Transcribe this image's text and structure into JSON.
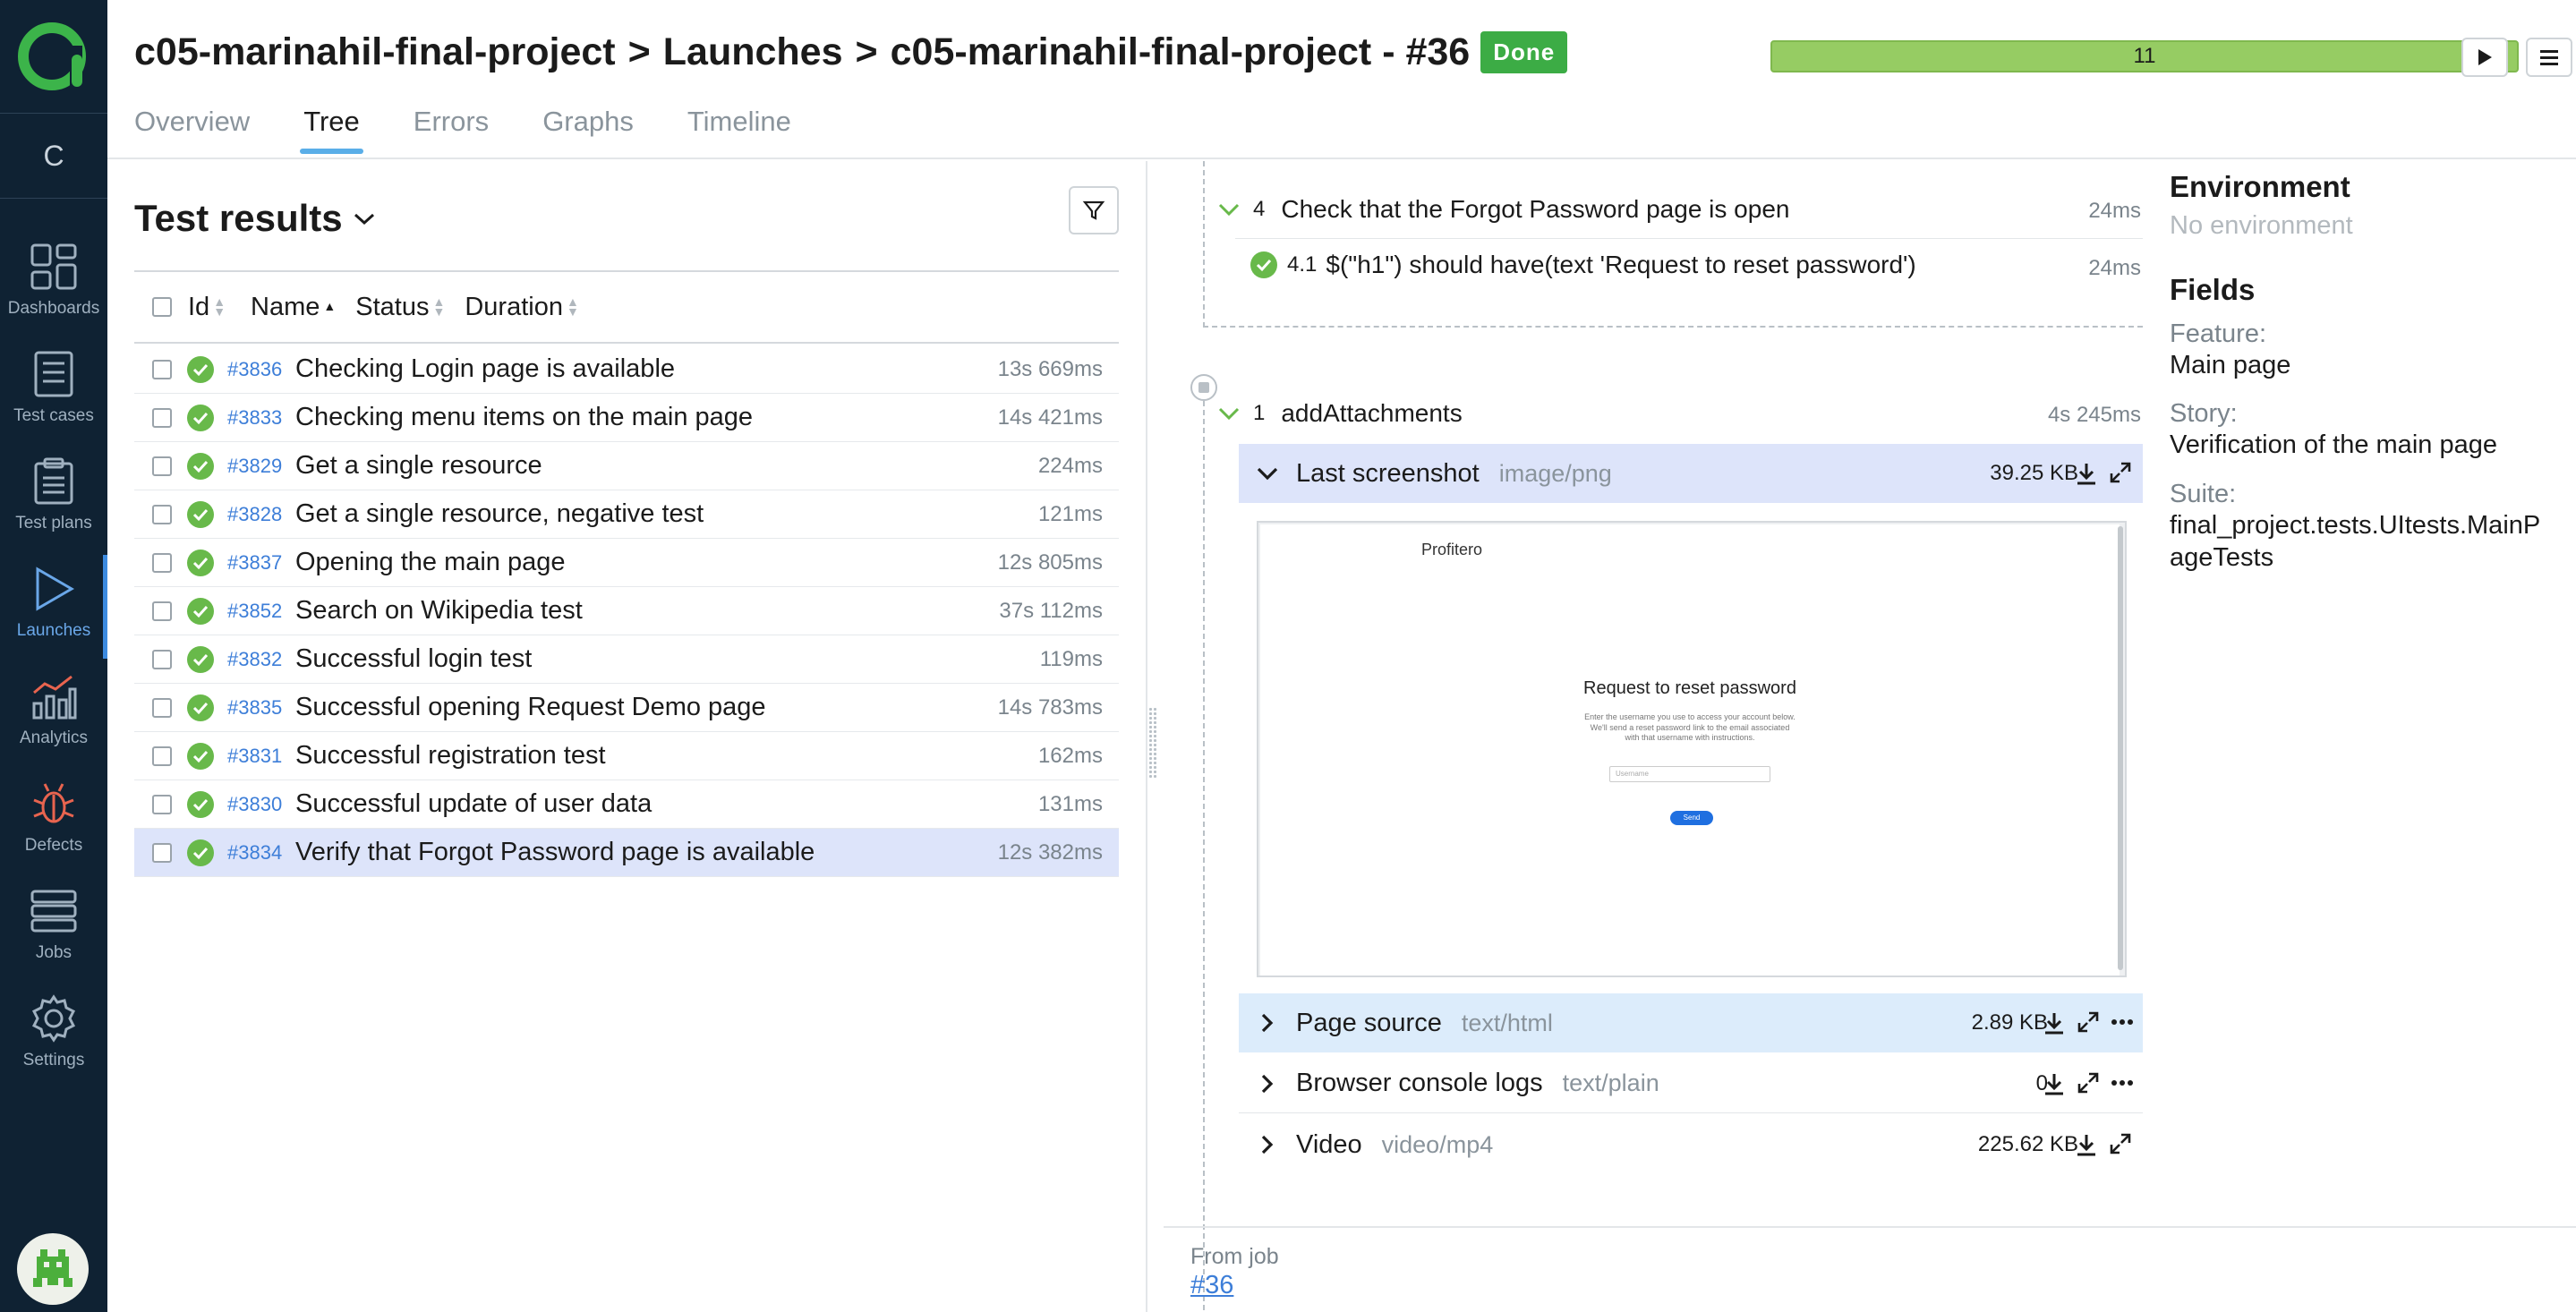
{
  "sidebar": {
    "project_initial": "C",
    "items": [
      {
        "label": "Dashboards",
        "icon": "dashboards-icon"
      },
      {
        "label": "Test cases",
        "icon": "test-cases-icon"
      },
      {
        "label": "Test plans",
        "icon": "test-plans-icon"
      },
      {
        "label": "Launches",
        "icon": "launches-icon",
        "active": true
      },
      {
        "label": "Analytics",
        "icon": "analytics-icon"
      },
      {
        "label": "Defects",
        "icon": "bug-icon"
      },
      {
        "label": "Jobs",
        "icon": "jobs-icon"
      },
      {
        "label": "Settings",
        "icon": "gear-icon"
      }
    ]
  },
  "header": {
    "breadcrumb": [
      "c05-marinahil-final-project",
      "Launches",
      "c05-marinahil-final-project - #36"
    ],
    "separator": ">",
    "status_badge": "Done",
    "progress_count": "11",
    "tabs": [
      "Overview",
      "Tree",
      "Errors",
      "Graphs",
      "Timeline"
    ],
    "active_tab": "Tree"
  },
  "test_results": {
    "title": "Test results",
    "columns": [
      "Id",
      "Name",
      "Status",
      "Duration"
    ],
    "rows": [
      {
        "id": "#3836",
        "name": "Checking Login page is available",
        "duration": "13s 669ms"
      },
      {
        "id": "#3833",
        "name": "Checking menu items on the main page",
        "duration": "14s 421ms"
      },
      {
        "id": "#3829",
        "name": "Get a single resource",
        "duration": "224ms"
      },
      {
        "id": "#3828",
        "name": "Get a single resource, negative test",
        "duration": "121ms"
      },
      {
        "id": "#3837",
        "name": "Opening the main page",
        "duration": "12s 805ms"
      },
      {
        "id": "#3852",
        "name": "Search on Wikipedia test",
        "duration": "37s 112ms"
      },
      {
        "id": "#3832",
        "name": "Successful login test",
        "duration": "119ms"
      },
      {
        "id": "#3835",
        "name": "Successful opening Request Demo page",
        "duration": "14s 783ms"
      },
      {
        "id": "#3831",
        "name": "Successful registration test",
        "duration": "162ms"
      },
      {
        "id": "#3830",
        "name": "Successful update of user data",
        "duration": "131ms"
      },
      {
        "id": "#3834",
        "name": "Verify that Forgot Password page is available",
        "duration": "12s 382ms",
        "selected": true
      }
    ]
  },
  "steps": {
    "step4": {
      "num": "4",
      "title": "Check that the Forgot Password page is open",
      "duration": "24ms"
    },
    "step4_1": {
      "num": "4.1",
      "title": "$(\"h1\") should have(text 'Request to reset password')",
      "duration": "24ms"
    },
    "after": {
      "num": "1",
      "title": "addAttachments",
      "duration": "4s 245ms"
    }
  },
  "attachments": [
    {
      "title": "Last screenshot",
      "mime": "image/png",
      "size": "39.25 KB",
      "expanded": true
    },
    {
      "title": "Page source",
      "mime": "text/html",
      "size": "2.89 KB"
    },
    {
      "title": "Browser console logs",
      "mime": "text/plain",
      "size": "0"
    },
    {
      "title": "Video",
      "mime": "video/mp4",
      "size": "225.62 KB"
    }
  ],
  "screenshot_preview": {
    "logo": "Profitero",
    "heading": "Request to reset password",
    "text": "Enter the username you use to access your account below. We'll send a reset password link to the email associated with that username with instructions.",
    "input_placeholder": "Username",
    "button": "Send"
  },
  "from_job": {
    "label": "From job",
    "link": "#36"
  },
  "right_panel": {
    "environment_title": "Environment",
    "environment_value": "No environment",
    "fields_title": "Fields",
    "fields": [
      {
        "label": "Feature:",
        "value": "Main page"
      },
      {
        "label": "Story:",
        "value": "Verification of the main page"
      },
      {
        "label": "Suite:",
        "value": "final_project.tests.UItests.MainPageTests"
      }
    ]
  },
  "colors": {
    "sidebar_bg": "#0f2233",
    "passed": "#68b94a",
    "accent": "#3d8be0",
    "done_badge": "#3cac45",
    "progress": "#96cc63"
  }
}
